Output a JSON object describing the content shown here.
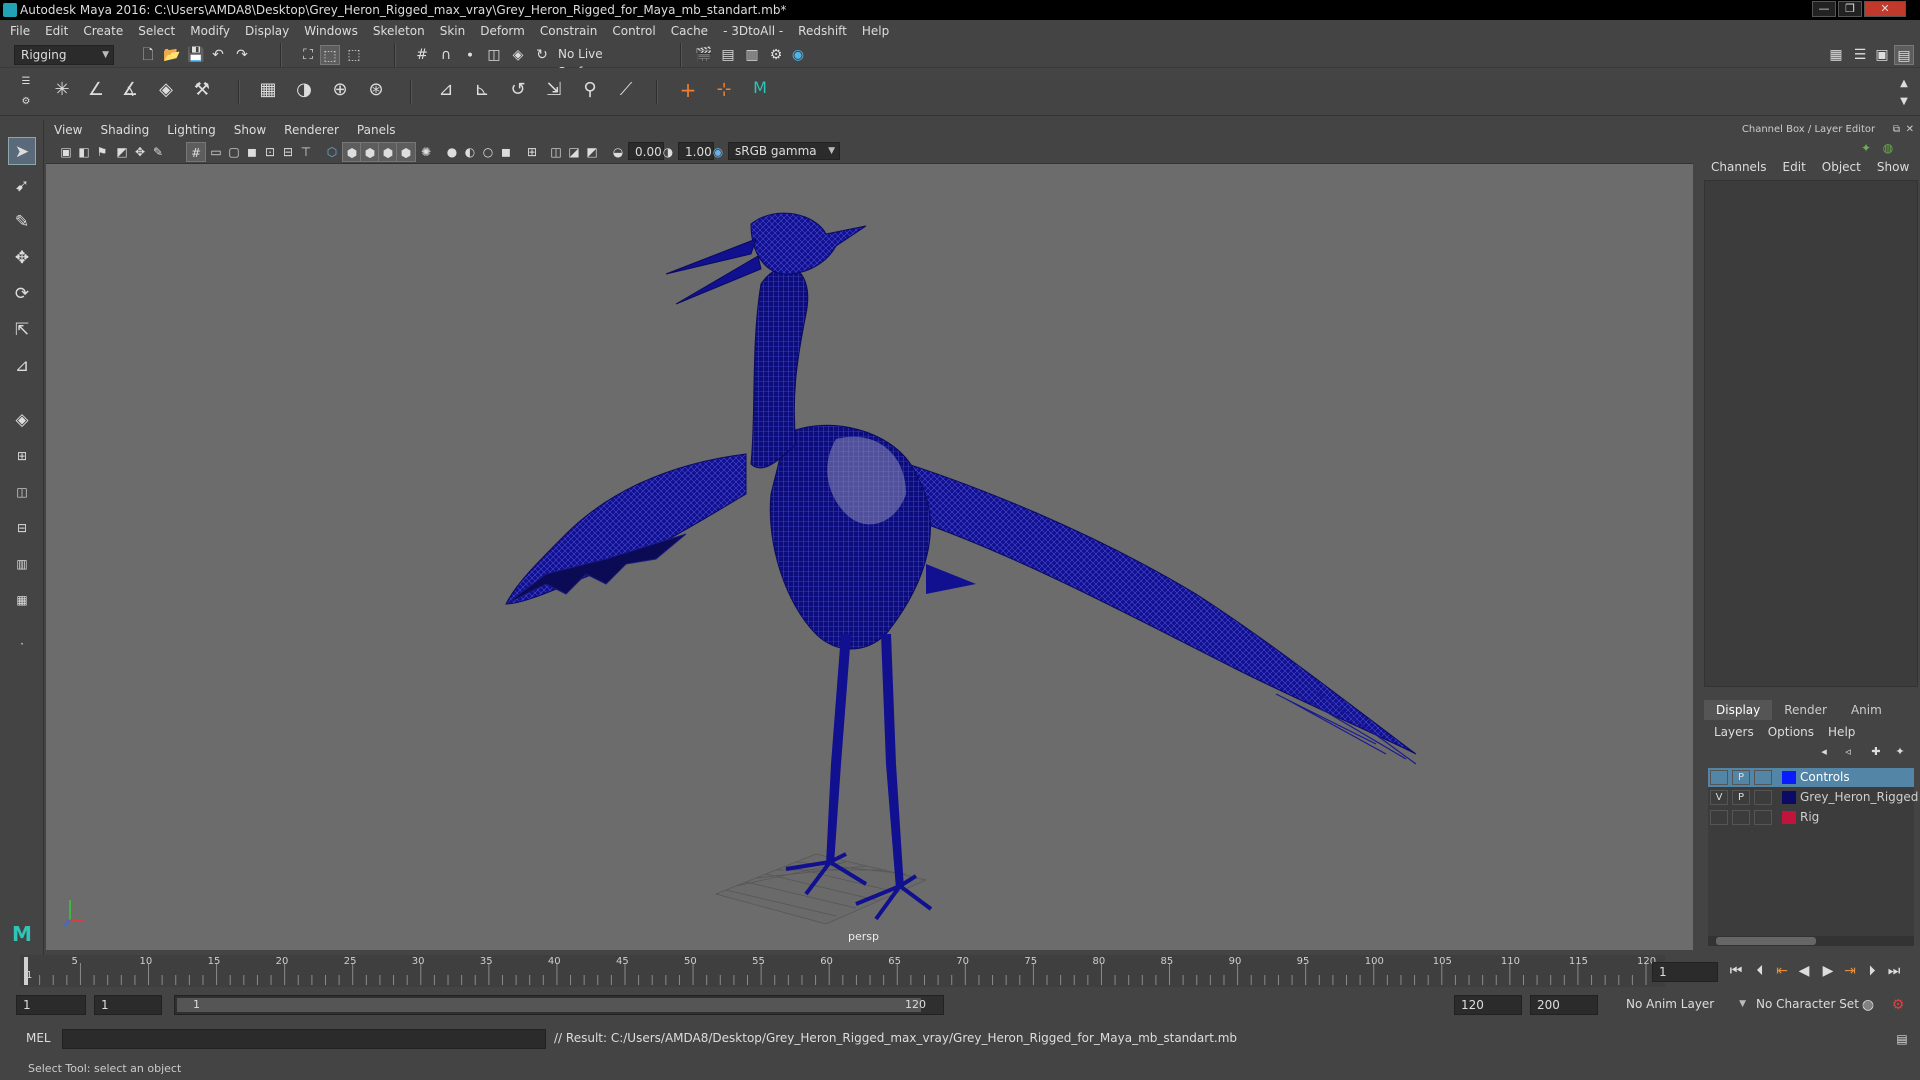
{
  "window": {
    "title": "Autodesk Maya 2016: C:\\Users\\AMDA8\\Desktop\\Grey_Heron_Rigged_max_vray\\Grey_Heron_Rigged_for_Maya_mb_standart.mb*",
    "minimize": "—",
    "maximize": "❐",
    "close": "✕"
  },
  "menubar": [
    "File",
    "Edit",
    "Create",
    "Select",
    "Modify",
    "Display",
    "Windows",
    "Skeleton",
    "Skin",
    "Deform",
    "Constrain",
    "Control",
    "Cache",
    "- 3DtoAll -",
    "Redshift",
    "Help"
  ],
  "statusline": {
    "mode": "Rigging",
    "live_surface": "No Live Surface"
  },
  "viewport": {
    "menu": [
      "View",
      "Shading",
      "Lighting",
      "Show",
      "Renderer",
      "Panels"
    ],
    "exposure": "0.00",
    "gamma": "1.00",
    "color_space": "sRGB gamma",
    "camera_label": "persp"
  },
  "channel_box": {
    "header": "Channel Box / Layer Editor",
    "menu": [
      "Channels",
      "Edit",
      "Object",
      "Show"
    ]
  },
  "layer_editor": {
    "tabs": [
      "Display",
      "Render",
      "Anim"
    ],
    "menu": [
      "Layers",
      "Options",
      "Help"
    ],
    "layers": [
      {
        "v": "",
        "p": "P",
        "name": "Controls",
        "color": "#0a1cff",
        "selected": true
      },
      {
        "v": "V",
        "p": "P",
        "name": "Grey_Heron_Rigged",
        "color": "#0b0b66",
        "selected": false
      },
      {
        "v": "",
        "p": "",
        "name": "Rig",
        "color": "#c0143c",
        "selected": false
      }
    ]
  },
  "timeslider": {
    "ticks": [
      5,
      10,
      15,
      20,
      25,
      30,
      35,
      40,
      45,
      50,
      55,
      60,
      65,
      70,
      75,
      80,
      85,
      90,
      95,
      100,
      105,
      110,
      115,
      120
    ],
    "start_label": "1",
    "max": 120,
    "current_frame": "1"
  },
  "rangebar": {
    "start_time": "1",
    "playback_start": "1",
    "range_start_label": "1",
    "range_end_label": "120",
    "playback_end": "120",
    "end_time": "200",
    "anim_layer": "No Anim Layer",
    "character_set": "No Character Set"
  },
  "commandline": {
    "language": "MEL",
    "result": "// Result: C:/Users/AMDA8/Desktop/Grey_Heron_Rigged_max_vray/Grey_Heron_Rigged_for_Maya_mb_standart.mb"
  },
  "helpline": "Select Tool: select an object"
}
